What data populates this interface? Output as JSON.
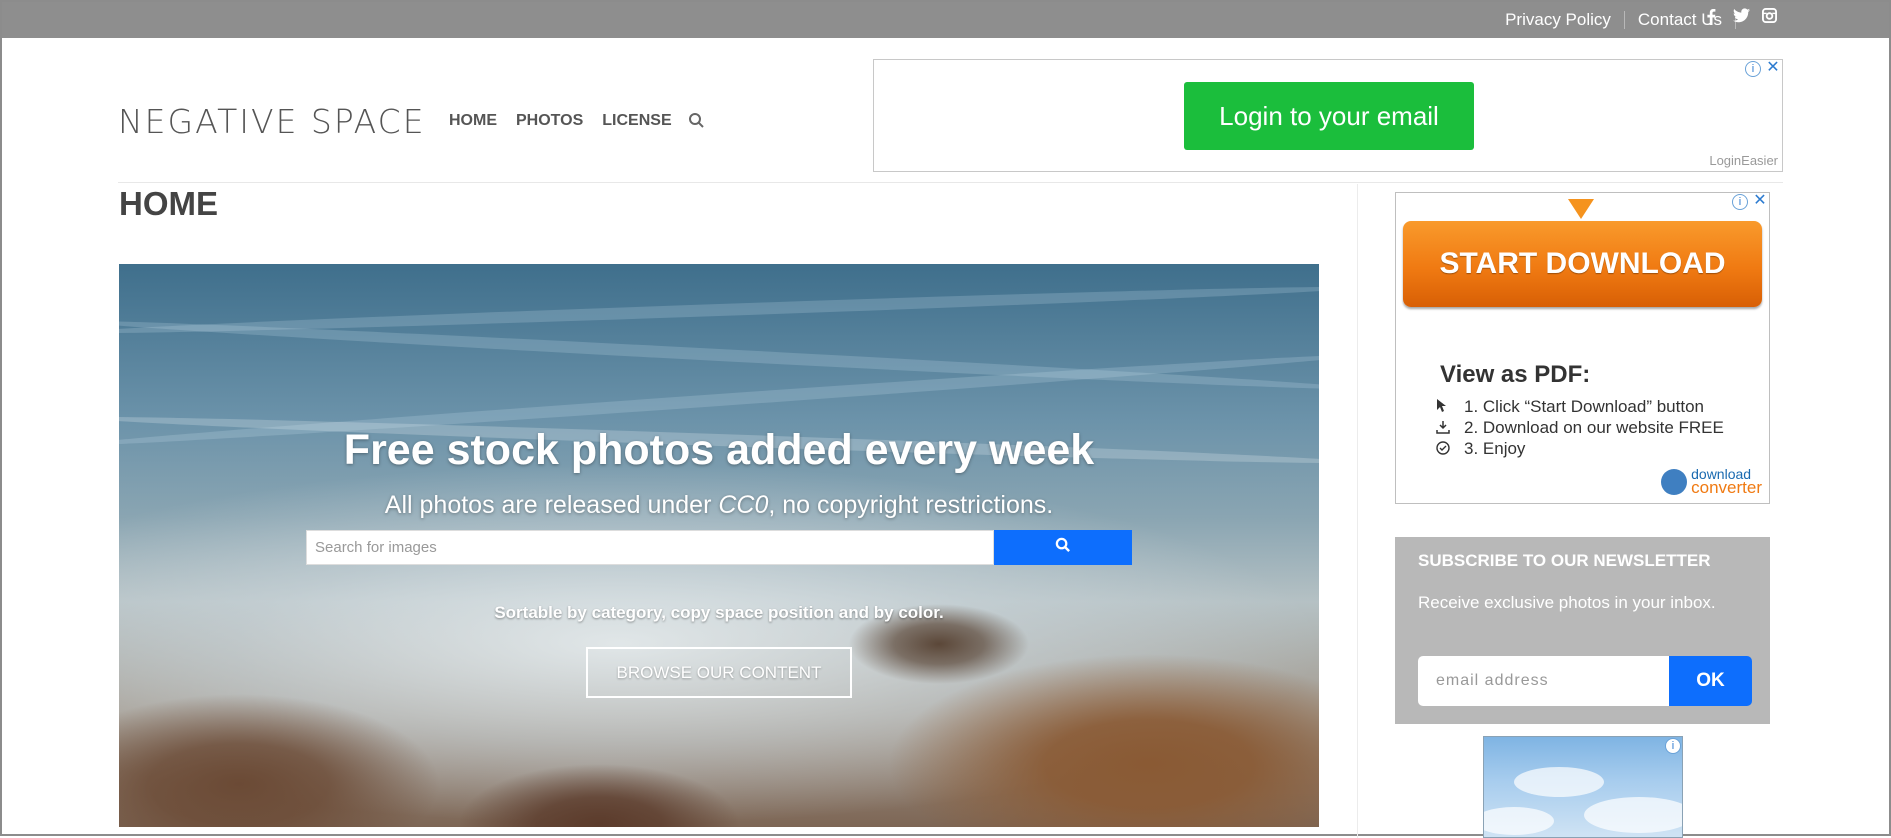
{
  "topbar": {
    "links": [
      "Privacy Policy",
      "Contact Us"
    ],
    "social_icons": [
      "facebook-icon",
      "twitter-icon",
      "instagram-icon"
    ]
  },
  "header": {
    "logo": "NEGATIVE SPACE",
    "nav": [
      "HOME",
      "PHOTOS",
      "LICENSE"
    ],
    "search_icon": "search-icon"
  },
  "ad_top": {
    "button": "Login to your email",
    "brand": "LoginEasier",
    "button_color": "#1bbe3c"
  },
  "page": {
    "title": "HOME"
  },
  "hero": {
    "headline": "Free stock photos added every week",
    "sub_before": "All photos are released under ",
    "sub_em": "CC0",
    "sub_after": ", no copyright restrictions.",
    "search_placeholder": "Search for images",
    "sortable": "Sortable by category, copy space position and by color.",
    "browse": "BROWSE OUR CONTENT",
    "accent": "#0d6efd"
  },
  "ad_side": {
    "button": "START DOWNLOAD",
    "heading": "View as PDF:",
    "steps": [
      "1. Click “Start Download” button",
      "2. Download on our website FREE",
      "3. Enjoy"
    ],
    "brand_top": "download",
    "brand_bottom": "converter"
  },
  "newsletter": {
    "heading": "SUBSCRIBE TO OUR NEWSLETTER",
    "text": "Receive exclusive photos in your inbox.",
    "email_placeholder": "email address",
    "button": "OK"
  }
}
